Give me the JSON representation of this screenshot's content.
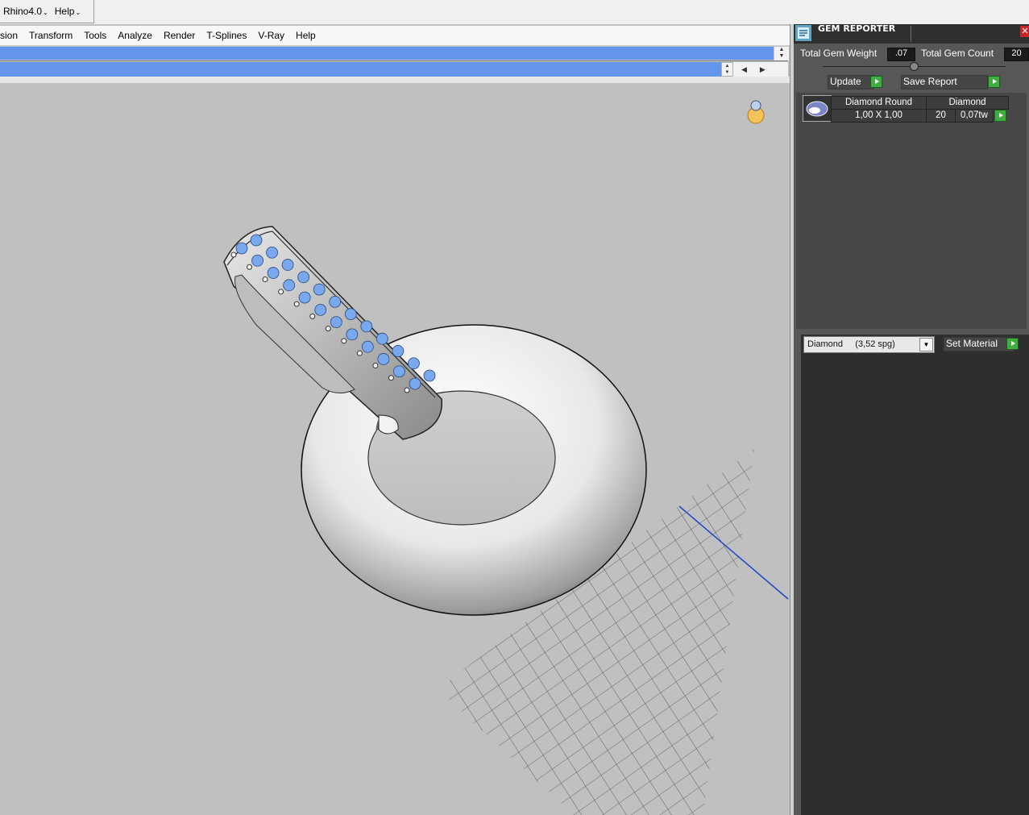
{
  "app_menu": {
    "items": [
      "Rhino4.0",
      "Help"
    ]
  },
  "rhino_menu": {
    "items": [
      "sion",
      "Transform",
      "Tools",
      "Analyze",
      "Render",
      "T-Splines",
      "V-Ray",
      "Help"
    ]
  },
  "gem_reporter": {
    "title": "GEM REPORTER",
    "close": "✕",
    "total_weight_label": "Total Gem Weight",
    "total_weight_value": ".07",
    "total_count_label": "Total Gem Count",
    "total_count_value": "20",
    "update_label": "Update",
    "save_report_label": "Save Report",
    "gems": [
      {
        "name": "Diamond Round",
        "material": "Diamond",
        "size": "1,00 X 1,00",
        "count": "20",
        "weight": "0,07tw"
      }
    ],
    "material_select": "Diamond     (3,52 spg)",
    "set_material_label": "Set Material"
  },
  "colors": {
    "command_bar": "#6495ed",
    "gem_blue": "#7aa8ee",
    "play_green": "#3fae3f"
  }
}
